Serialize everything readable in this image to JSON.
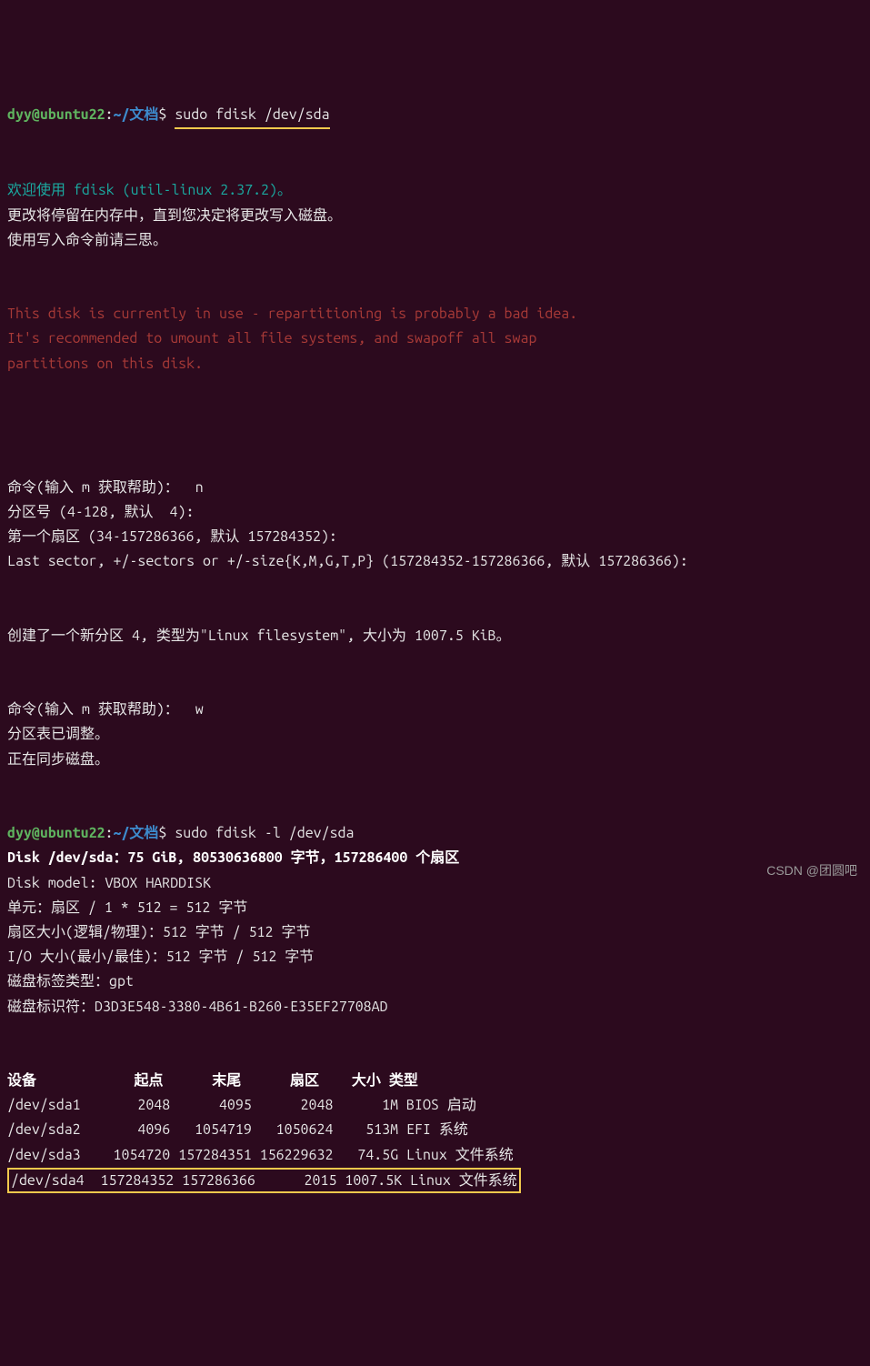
{
  "prompt1": {
    "user": "dyy@ubuntu22",
    "colon": ":",
    "path": "~/文档",
    "dollar": "$ ",
    "command": "sudo fdisk /dev/sda"
  },
  "welcome": "欢迎使用 fdisk (util-linux 2.37.2)。",
  "info1": "更改将停留在内存中，直到您决定将更改写入磁盘。",
  "info2": "使用写入命令前请三思。",
  "warn1": "This disk is currently in use - repartitioning is probably a bad idea.",
  "warn2": "It's recommended to umount all file systems, and swapoff all swap",
  "warn3": "partitions on this disk.",
  "cmd_n": "命令(输入 m 获取帮助)：  n",
  "part_num": "分区号 (4-128, 默认  4): ",
  "first_sector": "第一个扇区 (34-157286366, 默认 157284352): ",
  "last_sector": "Last sector, +/-sectors or +/-size{K,M,G,T,P} (157284352-157286366, 默认 157286366): ",
  "created": "创建了一个新分区 4, 类型为\"Linux filesystem\", 大小为 1007.5 KiB。",
  "cmd_w": "命令(输入 m 获取帮助)：  w",
  "adjusted": "分区表已调整。",
  "syncing": "正在同步磁盘。",
  "prompt2": {
    "user": "dyy@ubuntu22",
    "colon": ":",
    "path": "~/文档",
    "dollar": "$ ",
    "command": "sudo fdisk -l /dev/sda"
  },
  "disk_header": "Disk /dev/sda：75 GiB, 80530636800 字节，157286400 个扇区",
  "disk_model": "Disk model: VBOX HARDDISK   ",
  "unit": "单元：扇区 / 1 * 512 = 512 字节",
  "sector_size": "扇区大小(逻辑/物理)：512 字节 / 512 字节",
  "io_size": "I/O 大小(最小/最佳)：512 字节 / 512 字节",
  "label_type": "磁盘标签类型：gpt",
  "disk_id": "磁盘标识符：D3D3E548-3380-4B61-B260-E35EF27708AD",
  "table": {
    "header": "设备            起点      末尾      扇区    大小 类型",
    "rows": [
      "/dev/sda1       2048      4095      2048      1M BIOS 启动",
      "/dev/sda2       4096   1054719   1050624    513M EFI 系统",
      "/dev/sda3    1054720 157284351 156229632   74.5G Linux 文件系统"
    ],
    "highlighted_row": "/dev/sda4  157284352 157286366      2015 1007.5K Linux 文件系统"
  },
  "watermark": "CSDN @团圆吧"
}
